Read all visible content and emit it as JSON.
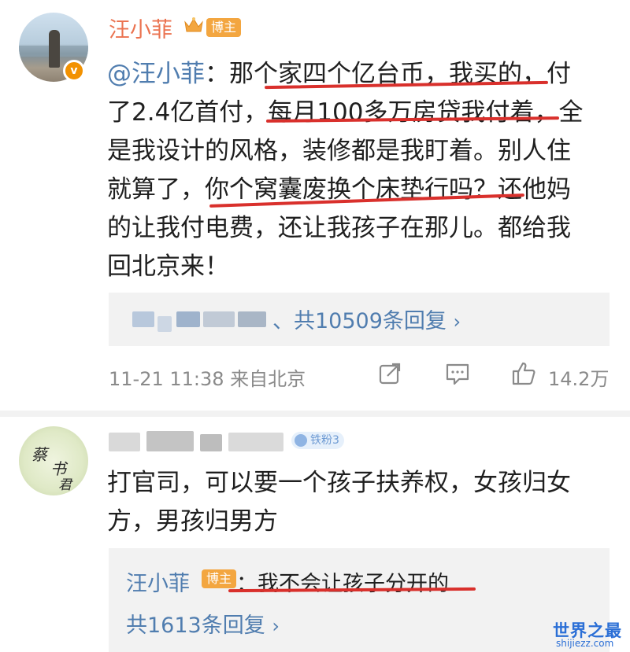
{
  "post": {
    "author": "汪小菲",
    "author_tag": "博主",
    "body_mention": "@汪小菲",
    "body_lines": [
      "：那个家四个亿台币，我买的，付",
      "了2.4亿首付，每月100多万房贷我付着，全",
      "是我设计的风格，装修都是我盯着。别人住",
      "就算了，你个窝囊废换个床垫行吗？还他妈",
      "的让我付电费，还让我孩子在那儿。都给我",
      "回北京来！"
    ],
    "reply_summary": "、共10509条回复",
    "timestamp": "11-21 11:38",
    "source": "来自北京",
    "like_count": "14.2万",
    "icons": [
      "verified-icon",
      "crown-icon",
      "share-icon",
      "comment-icon",
      "like-icon",
      "chevron-right-icon"
    ]
  },
  "comment": {
    "fan_badge": "铁粉3",
    "text_lines": [
      "打官司，可以要一个孩子扶养权，女孩归女",
      "方，男孩归男方"
    ],
    "avatar_text": [
      "蔡",
      "书",
      "君"
    ],
    "sub_reply": {
      "author": "汪小菲",
      "author_tag": "博主",
      "text": "：我不会让孩子分开的",
      "count": "共1613条回复"
    }
  },
  "watermark": {
    "title": "世界之最",
    "url": "shijiezz.com"
  },
  "colors": {
    "name_orange": "#eb7350",
    "link_blue": "#507daf",
    "underline_red": "#d9302c",
    "tag_orange": "#f3a640"
  }
}
